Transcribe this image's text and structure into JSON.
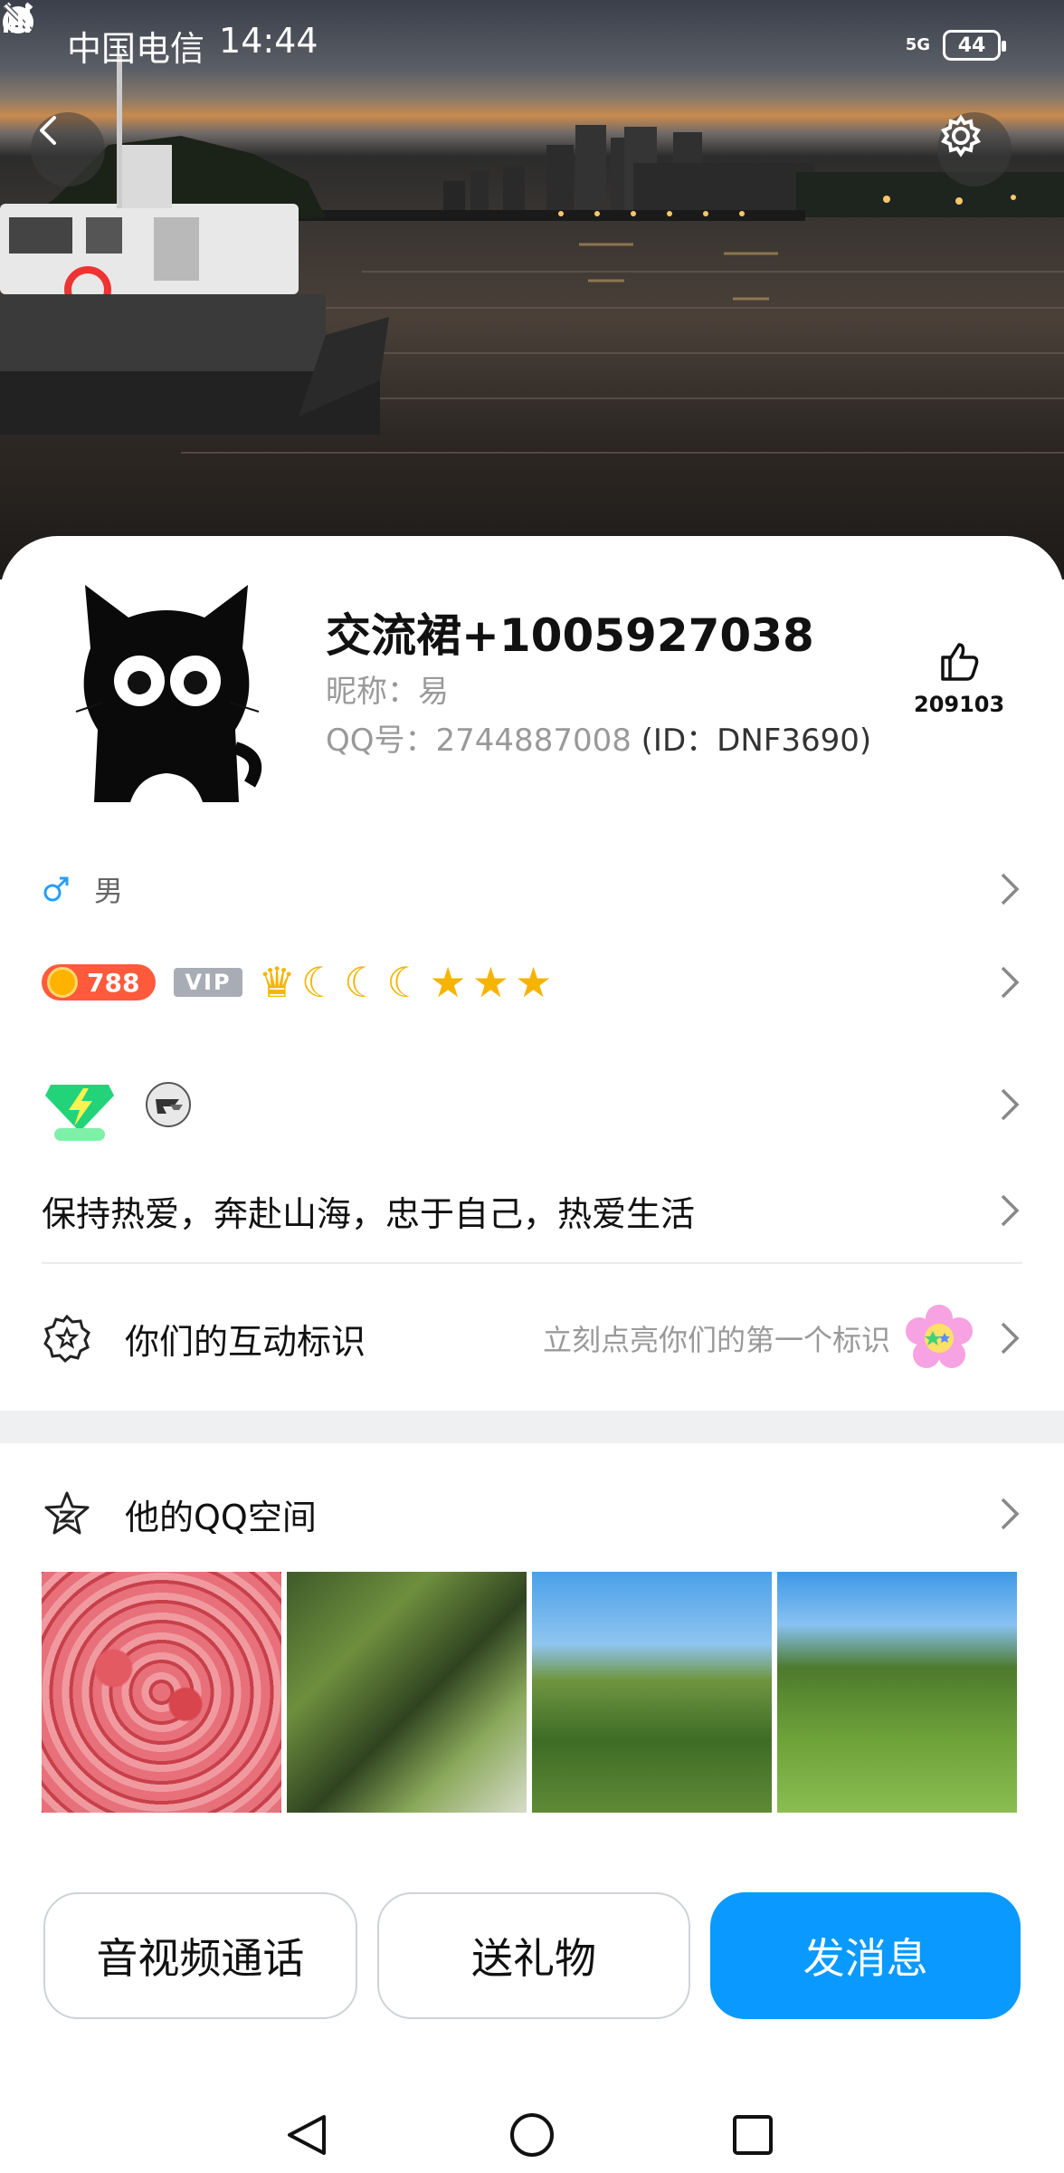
{
  "status_bar": {
    "carrier": "中国电信",
    "time": "14:44",
    "network": "5G",
    "battery": "44"
  },
  "profile": {
    "name": "交流裙+1005927038",
    "nickname_label": "昵称：",
    "nickname": "易",
    "qq_label": "QQ号：",
    "qq_number": "2744887008",
    "id_text": "(ID：DNF3690)",
    "like_count": "209103"
  },
  "info": {
    "gender": "男",
    "coin_value": "788",
    "vip_label": "VIP",
    "signature": "保持热爱，奔赴山海，忠于自己，热爱生活"
  },
  "interaction": {
    "title": "你们的互动标识",
    "hint": "立刻点亮你们的第一个标识"
  },
  "qzone": {
    "title": "他的QQ空间"
  },
  "actions": {
    "call": "音视频通话",
    "gift": "送礼物",
    "message": "发消息"
  },
  "colors": {
    "primary": "#0a99ff",
    "gender": "#2a9df4",
    "coin": "#ff5a3c"
  }
}
